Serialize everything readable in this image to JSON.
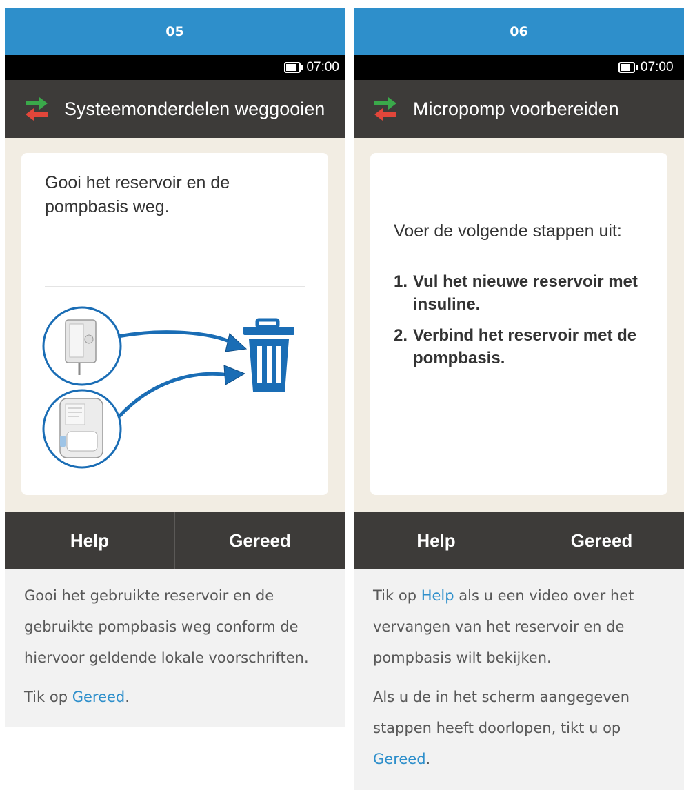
{
  "panels": [
    {
      "step": "05",
      "status_time": "07:00",
      "title": "Systeemonderdelen weggooien",
      "instruction": "Gooi het reservoir en de pompbasis weg.",
      "buttons": {
        "left": "Help",
        "right": "Gereed"
      },
      "description": [
        "Gooi het gebruikte reservoir en de gebruikte pompbasis weg conform de hiervoor geldende lokale voorschriften."
      ],
      "tap_prefix": "Tik op ",
      "tap_link": "Gereed",
      "tap_suffix": ".",
      "illustration": [
        "reservoir-image",
        "pump-base-image",
        "arrow-icon",
        "trash-bin-icon"
      ]
    },
    {
      "step": "06",
      "status_time": "07:00",
      "title": "Micropomp voorbereiden",
      "instruction": "Voer de volgende stappen uit:",
      "steps": [
        {
          "num": "1.",
          "text": "Vul het nieuwe reservoir met insuline."
        },
        {
          "num": "2.",
          "text": "Verbind het reservoir met de pompbasis."
        }
      ],
      "buttons": {
        "left": "Help",
        "right": "Gereed"
      },
      "desc1_prefix": "Tik op ",
      "desc1_link": "Help",
      "desc1_suffix": " als u een video over het vervangen van het reservoir en de pompbasis wilt bekijken.",
      "desc2_prefix": "Als u de in het scherm aangegeven stappen heeft doorlopen, tikt u op ",
      "desc2_link": "Gereed",
      "desc2_suffix": "."
    }
  ],
  "colors": {
    "header_blue": "#2e8fcb",
    "bar_dark": "#3d3b39",
    "screen_bg": "#f2ede3",
    "arrow_green": "#3aa94a",
    "arrow_red": "#e2463a",
    "link": "#2e8fcb",
    "trash_blue": "#1a6db5"
  }
}
